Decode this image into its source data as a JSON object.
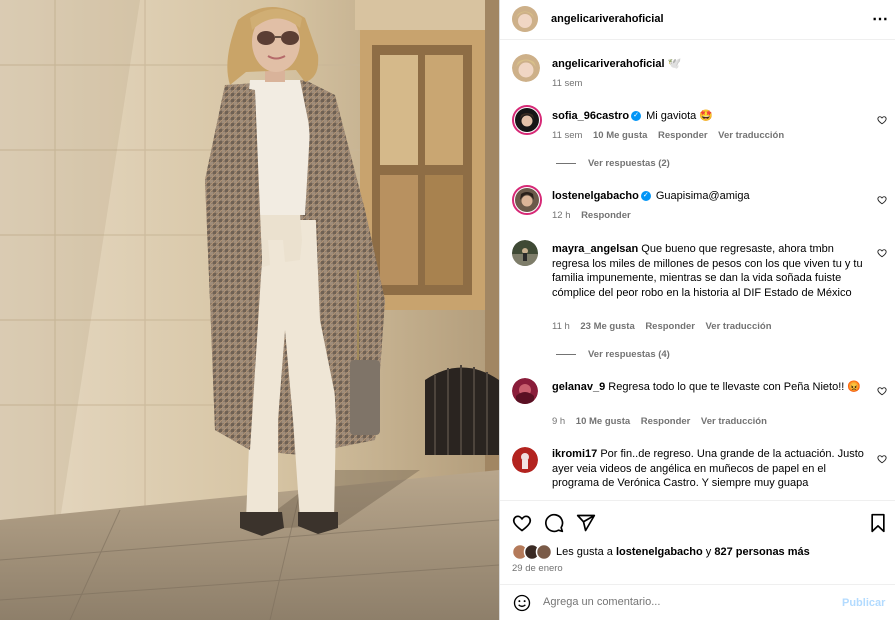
{
  "post": {
    "author": "angelicariverahoficial",
    "caption_emoji": "🕊️",
    "caption_time": "11 sem"
  },
  "comments": [
    {
      "username": "sofia_96castro",
      "verified": true,
      "text": "Mi gaviota 🤩",
      "time": "11 sem",
      "likes": "10 Me gusta",
      "reply": "Responder",
      "translate": "Ver traducción",
      "view_replies": "Ver respuestas (2)"
    },
    {
      "username": "lostenelgabacho",
      "verified": true,
      "text": "Guapisima@amiga",
      "time": "12 h",
      "reply": "Responder"
    },
    {
      "username": "mayra_angelsan",
      "verified": false,
      "text": "Que bueno que regresaste, ahora tmbn regresa los miles de millones de pesos con los que viven tu y tu familia impunemente, mientras se dan la vida soñada fuiste cómplice del peor robo en la historia al DIF Estado de México",
      "time": "11 h",
      "likes": "23 Me gusta",
      "reply": "Responder",
      "translate": "Ver traducción",
      "view_replies": "Ver respuestas (4)"
    },
    {
      "username": "gelanav_9",
      "verified": false,
      "text": "Regresa todo lo que te llevaste con Peña Nieto!! 😡",
      "time": "9 h",
      "likes": "10 Me gusta",
      "reply": "Responder",
      "translate": "Ver traducción"
    },
    {
      "username": "ikromi17",
      "verified": false,
      "text": "Por fin..de regreso. Una grande de la actuación. Justo ayer veia videos de angélica en muñecos de papel en el programa de Verónica Castro. Y siempre muy guapa"
    }
  ],
  "likes_summary": {
    "prefix": "Les gusta a",
    "user": "lostenelgabacho",
    "connector": "y",
    "others": "827 personas más"
  },
  "post_date": "29 de enero",
  "composer": {
    "placeholder": "Agrega un comentario...",
    "publish_label": "Publicar"
  },
  "icons": {
    "more": "more-horizontal-icon",
    "like": "heart-icon",
    "comment": "comment-icon",
    "share": "share-icon",
    "save": "bookmark-icon",
    "emoji": "emoji-icon"
  },
  "colors": {
    "link": "#0095f6",
    "secondary_text": "#737373",
    "story_ring": "#d62976"
  }
}
